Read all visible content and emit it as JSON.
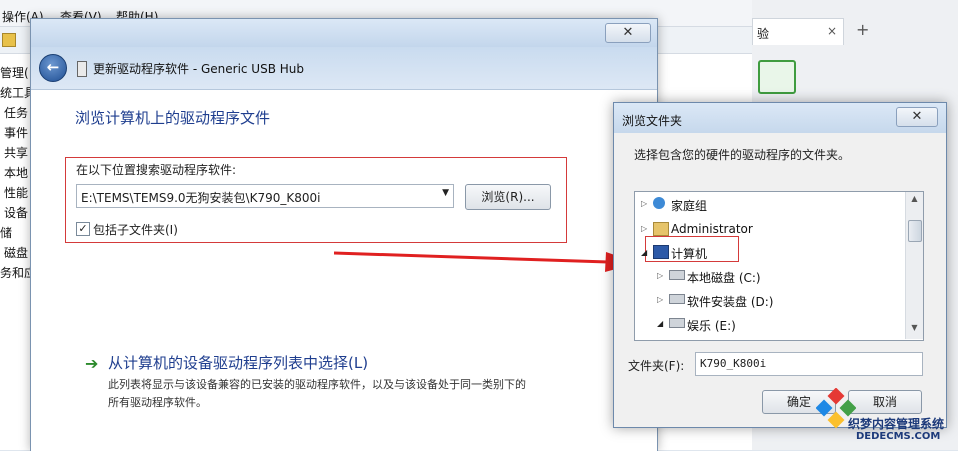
{
  "background_window": {
    "menu": [
      "操作(A)",
      "查看(V)",
      "帮助(H)"
    ],
    "tree_items": [
      "管理(",
      "统工具",
      "任务",
      "事件",
      "共享",
      "本地",
      "性能",
      "设备",
      "储",
      "磁盘",
      "务和应"
    ]
  },
  "right_app": {
    "tab_label": "验",
    "close_glyph": "×",
    "plus_glyph": "+"
  },
  "wizard": {
    "title": "更新驱动程序软件 - Generic USB Hub",
    "close_glyph": "✕",
    "back_glyph": "←",
    "heading": "浏览计算机上的驱动程序文件",
    "search_label": "在以下位置搜索驱动程序软件:",
    "path_value": "E:\\TEMS\\TEMS9.0无狗安装包\\K790_K800i",
    "browse_label": "浏览(R)...",
    "include_subfolders_label": "包括子文件夹(I)",
    "include_subfolders_checked": "✓",
    "pick_title": "从计算机的设备驱动程序列表中选择(L)",
    "pick_desc_line1": "此列表将显示与该设备兼容的已安装的驱动程序软件，以及与该设备处于同一类别下的",
    "pick_desc_line2": "所有驱动程序软件。"
  },
  "folder_dialog": {
    "title": "浏览文件夹",
    "close_glyph": "✕",
    "prompt": "选择包含您的硬件的驱动程序的文件夹。",
    "tree": [
      {
        "label": "家庭组",
        "icon": "homegroup-icon"
      },
      {
        "label": "Administrator",
        "icon": "user-folder-icon"
      },
      {
        "label": "计算机",
        "icon": "computer-icon"
      },
      {
        "label": "本地磁盘 (C:)",
        "icon": "drive-icon"
      },
      {
        "label": "软件安装盘 (D:)",
        "icon": "drive-icon"
      },
      {
        "label": "娱乐 (E:)",
        "icon": "drive-icon"
      }
    ],
    "folder_label": "文件夹(F):",
    "folder_value": "K790_K800i",
    "ok_label": "确定",
    "cancel_label": "取消"
  },
  "watermark": {
    "text": "织梦内容管理系统",
    "url": "DEDECMS.COM"
  },
  "colors": {
    "highlight_red": "#d43a3a",
    "heading_blue": "#1f3e8f"
  }
}
